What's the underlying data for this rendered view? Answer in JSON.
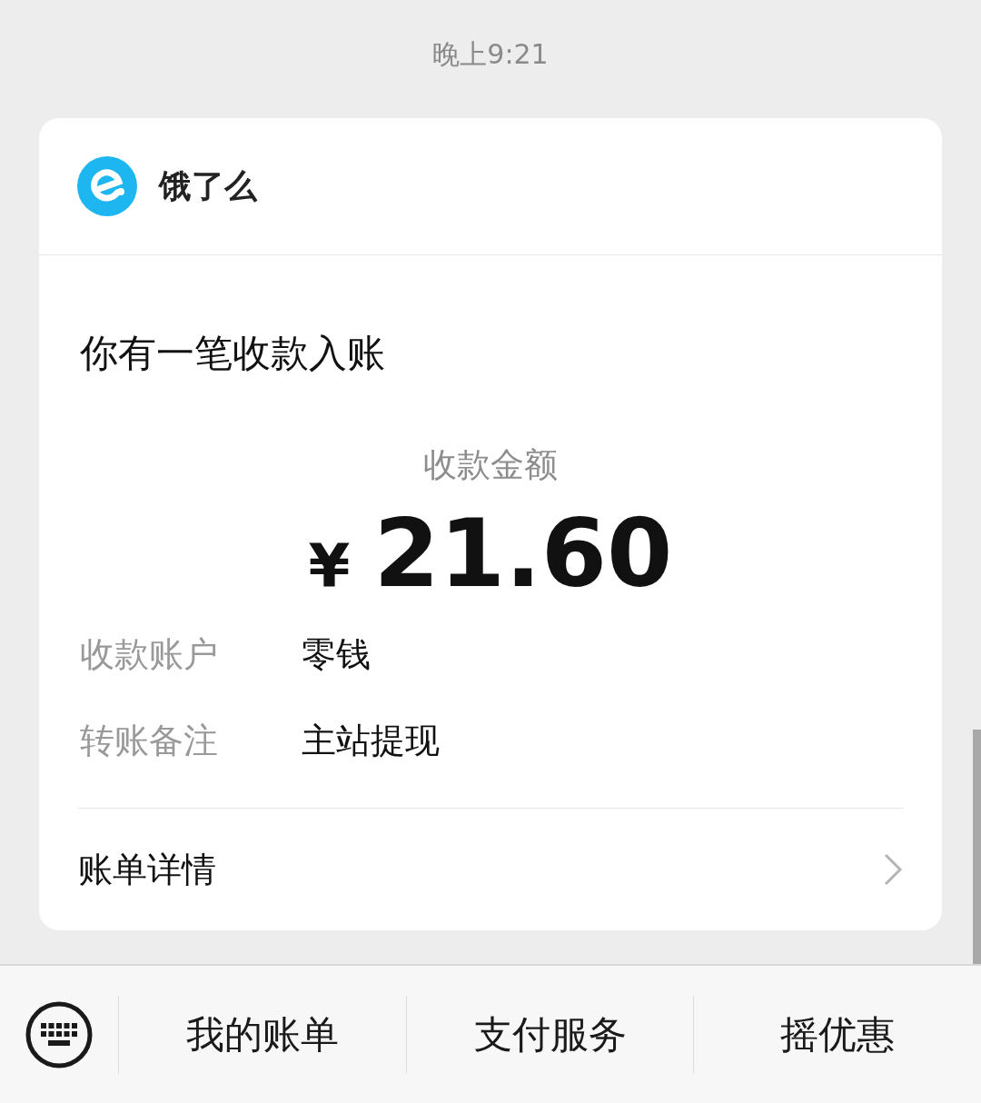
{
  "time": "晚上9:21",
  "card": {
    "merchant": "饿了么",
    "title": "你有一笔收款入账",
    "amount_label": "收款金额",
    "currency": "¥",
    "amount": "21.60",
    "details": [
      {
        "label": "收款账户",
        "value": "零钱"
      },
      {
        "label": "转账备注",
        "value": "主站提现"
      }
    ],
    "footer_link": "账单详情"
  },
  "menu": [
    "我的账单",
    "支付服务",
    "摇优惠"
  ]
}
